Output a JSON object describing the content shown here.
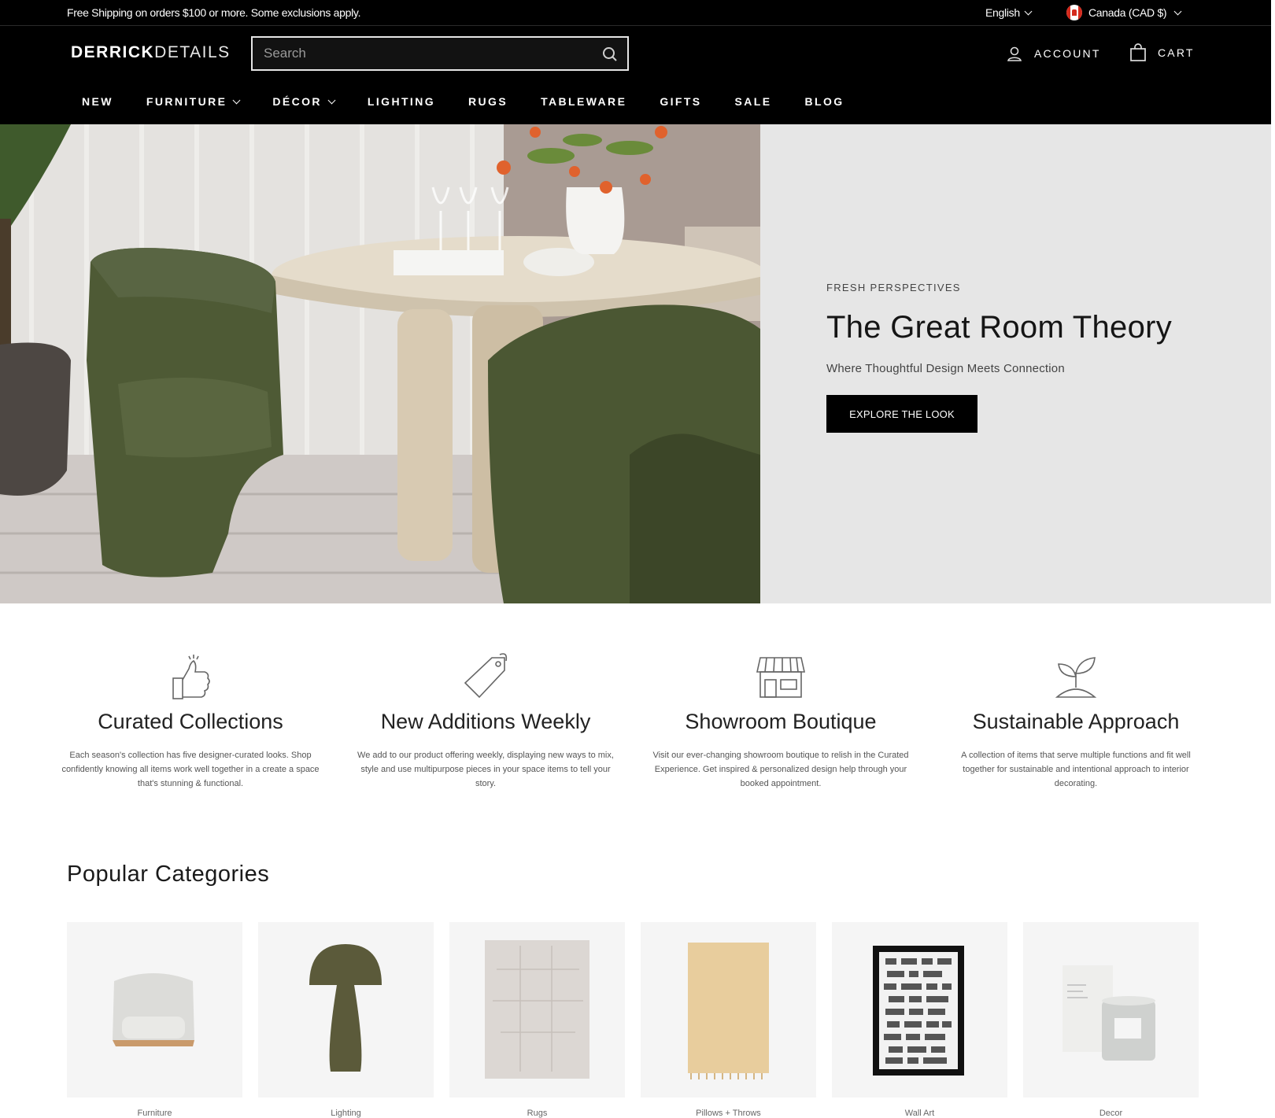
{
  "topbar": {
    "promo": "Free Shipping on orders $100 or more. Some exclusions apply.",
    "language": "English",
    "currency": "Canada (CAD $)"
  },
  "header": {
    "logo_bold": "DERRICK",
    "logo_light": "DETAILS",
    "search_placeholder": "Search",
    "account_label": "ACCOUNT",
    "cart_label": "CART"
  },
  "nav": {
    "items": [
      {
        "label": "NEW",
        "dropdown": false
      },
      {
        "label": "FURNITURE",
        "dropdown": true
      },
      {
        "label": "DÉCOR",
        "dropdown": true
      },
      {
        "label": "LIGHTING",
        "dropdown": false
      },
      {
        "label": "RUGS",
        "dropdown": false
      },
      {
        "label": "TABLEWARE",
        "dropdown": false
      },
      {
        "label": "GIFTS",
        "dropdown": false
      },
      {
        "label": "SALE",
        "dropdown": false
      },
      {
        "label": "BLOG",
        "dropdown": false
      }
    ]
  },
  "hero": {
    "eyebrow": "FRESH PERSPECTIVES",
    "title": "The Great Room Theory",
    "subtitle": "Where Thoughtful Design Meets Connection",
    "button": "EXPLORE THE LOOK"
  },
  "features": [
    {
      "icon": "thumbs-up-icon",
      "title": "Curated Collections",
      "text": "Each season's collection has five designer-curated looks. Shop confidently knowing all items work well together in a create a space that's stunning & functional."
    },
    {
      "icon": "price-tag-icon",
      "title": "New Additions Weekly",
      "text": "We add to our product offering weekly, displaying new ways to mix, style and use multipurpose pieces in your space items to tell your story."
    },
    {
      "icon": "storefront-icon",
      "title": "Showroom Boutique",
      "text": "Visit our ever-changing showroom boutique to relish in the Curated Experience. Get inspired & personalized design help through your booked appointment."
    },
    {
      "icon": "sprout-icon",
      "title": "Sustainable Approach",
      "text": "A collection of items that serve multiple functions and fit well together for sustainable and intentional approach to interior decorating."
    }
  ],
  "popular": {
    "title": "Popular Categories",
    "categories": [
      {
        "label": "Furniture"
      },
      {
        "label": "Lighting"
      },
      {
        "label": "Rugs"
      },
      {
        "label": "Pillows + Throws"
      },
      {
        "label": "Wall Art"
      },
      {
        "label": "Decor"
      }
    ]
  },
  "colors": {
    "header_bg": "#000000",
    "hero_panel_bg": "#e6e6e6",
    "chair_green": "#4e5a35",
    "lamp_olive": "#5b5a3a"
  }
}
